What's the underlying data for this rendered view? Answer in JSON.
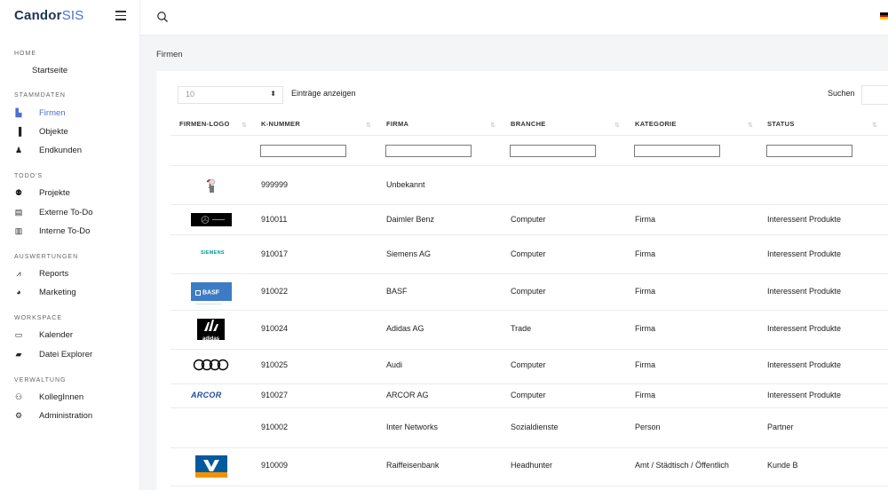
{
  "app": {
    "brand_main": "Candor",
    "brand_accent": "SIS"
  },
  "sidebar": {
    "sections": [
      {
        "label": "HOME"
      },
      {
        "label": "STAMMDATEN"
      },
      {
        "label": "TODO'S"
      },
      {
        "label": "AUSWERTUNGEN"
      },
      {
        "label": "WORKSPACE"
      },
      {
        "label": "VERWALTUNG"
      }
    ],
    "items": [
      {
        "label": "Startseite",
        "icon": "none"
      },
      {
        "label": "Firmen",
        "icon": "bar-chart-icon"
      },
      {
        "label": "Objekte",
        "icon": "building-icon"
      },
      {
        "label": "Endkunden",
        "icon": "person-icon"
      },
      {
        "label": "Projekte",
        "icon": "team-icon"
      },
      {
        "label": "Externe To-Do",
        "icon": "list-icon"
      },
      {
        "label": "Interne To-Do",
        "icon": "list-icon"
      },
      {
        "label": "Reports",
        "icon": "line-chart-icon"
      },
      {
        "label": "Marketing",
        "icon": "pie-chart-icon"
      },
      {
        "label": "Kalender",
        "icon": "calendar-icon"
      },
      {
        "label": "Datei Explorer",
        "icon": "folder-icon"
      },
      {
        "label": "KollegInnen",
        "icon": "users-icon"
      },
      {
        "label": "Administration",
        "icon": "cogs-icon"
      }
    ]
  },
  "breadcrumb": "Firmen",
  "table_controls": {
    "entries_value": "10",
    "entries_label": "Einträge anzeigen",
    "search_label": "Suchen"
  },
  "table": {
    "headers": [
      "FIRMEN-LOGO",
      "K-NUMMER",
      "FIRMA",
      "BRANCHE",
      "KATEGORIE",
      "STATUS"
    ],
    "rows": [
      {
        "logo": "unbekannt-logo",
        "k_nummer": "999999",
        "firma": "Unbekannt",
        "branche": "",
        "kategorie": "",
        "status": ""
      },
      {
        "logo": "mercedes-logo",
        "k_nummer": "910011",
        "firma": "Daimler Benz",
        "branche": "Computer",
        "kategorie": "Firma",
        "status": "Interessent Produkte"
      },
      {
        "logo": "siemens-logo",
        "logo_text": "SIEMENS",
        "k_nummer": "910017",
        "firma": "Siemens AG",
        "branche": "Computer",
        "kategorie": "Firma",
        "status": "Interessent Produkte"
      },
      {
        "logo": "basf-logo",
        "logo_text": "BASF",
        "k_nummer": "910022",
        "firma": "BASF",
        "branche": "Computer",
        "kategorie": "Firma",
        "status": "Interessent Produkte"
      },
      {
        "logo": "adidas-logo",
        "logo_text": "adidas",
        "k_nummer": "910024",
        "firma": "Adidas AG",
        "branche": "Trade",
        "kategorie": "Firma",
        "status": "Interessent Produkte"
      },
      {
        "logo": "audi-logo",
        "k_nummer": "910025",
        "firma": "Audi",
        "branche": "Computer",
        "kategorie": "Firma",
        "status": "Interessent Produkte"
      },
      {
        "logo": "arcor-logo",
        "logo_text": "ARCOR",
        "k_nummer": "910027",
        "firma": "ARCOR AG",
        "branche": "Computer",
        "kategorie": "Firma",
        "status": "Interessent Produkte"
      },
      {
        "logo": "",
        "k_nummer": "910002",
        "firma": "Inter Networks",
        "branche": "Sozialdienste",
        "kategorie": "Person",
        "status": "Partner"
      },
      {
        "logo": "raiffeisen-logo",
        "k_nummer": "910009",
        "firma": "Raiffeisenbank",
        "branche": "Headhunter",
        "kategorie": "Amt / Städtisch / Öffentlich",
        "status": "Kunde B"
      }
    ]
  },
  "colors": {
    "accent": "#4a6fd1",
    "brand": "#1d3557",
    "basf_blue": "#3d7cc4",
    "raiffeisen_blue": "#005aa0",
    "raiffeisen_orange": "#f39200",
    "arcor_blue": "#1f4a9c",
    "siemens_teal": "#009999"
  }
}
